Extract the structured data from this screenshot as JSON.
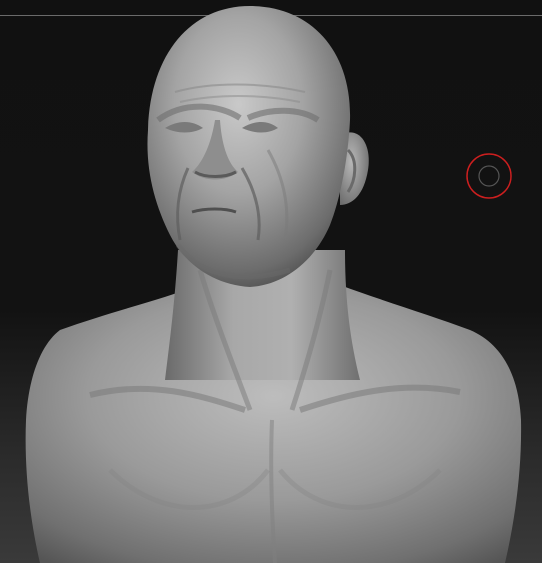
{
  "viewport": {
    "background_top": "#111111",
    "background_bottom": "#3a3a3a",
    "divider_color": "#6b6b6b"
  },
  "model": {
    "name_icon": "sculpted-bust-model",
    "material_color": "#9a9a9a"
  },
  "cursor": {
    "icon": "brush-cursor-icon",
    "outer_color": "#cc1f1f",
    "inner_color": "#555555"
  }
}
